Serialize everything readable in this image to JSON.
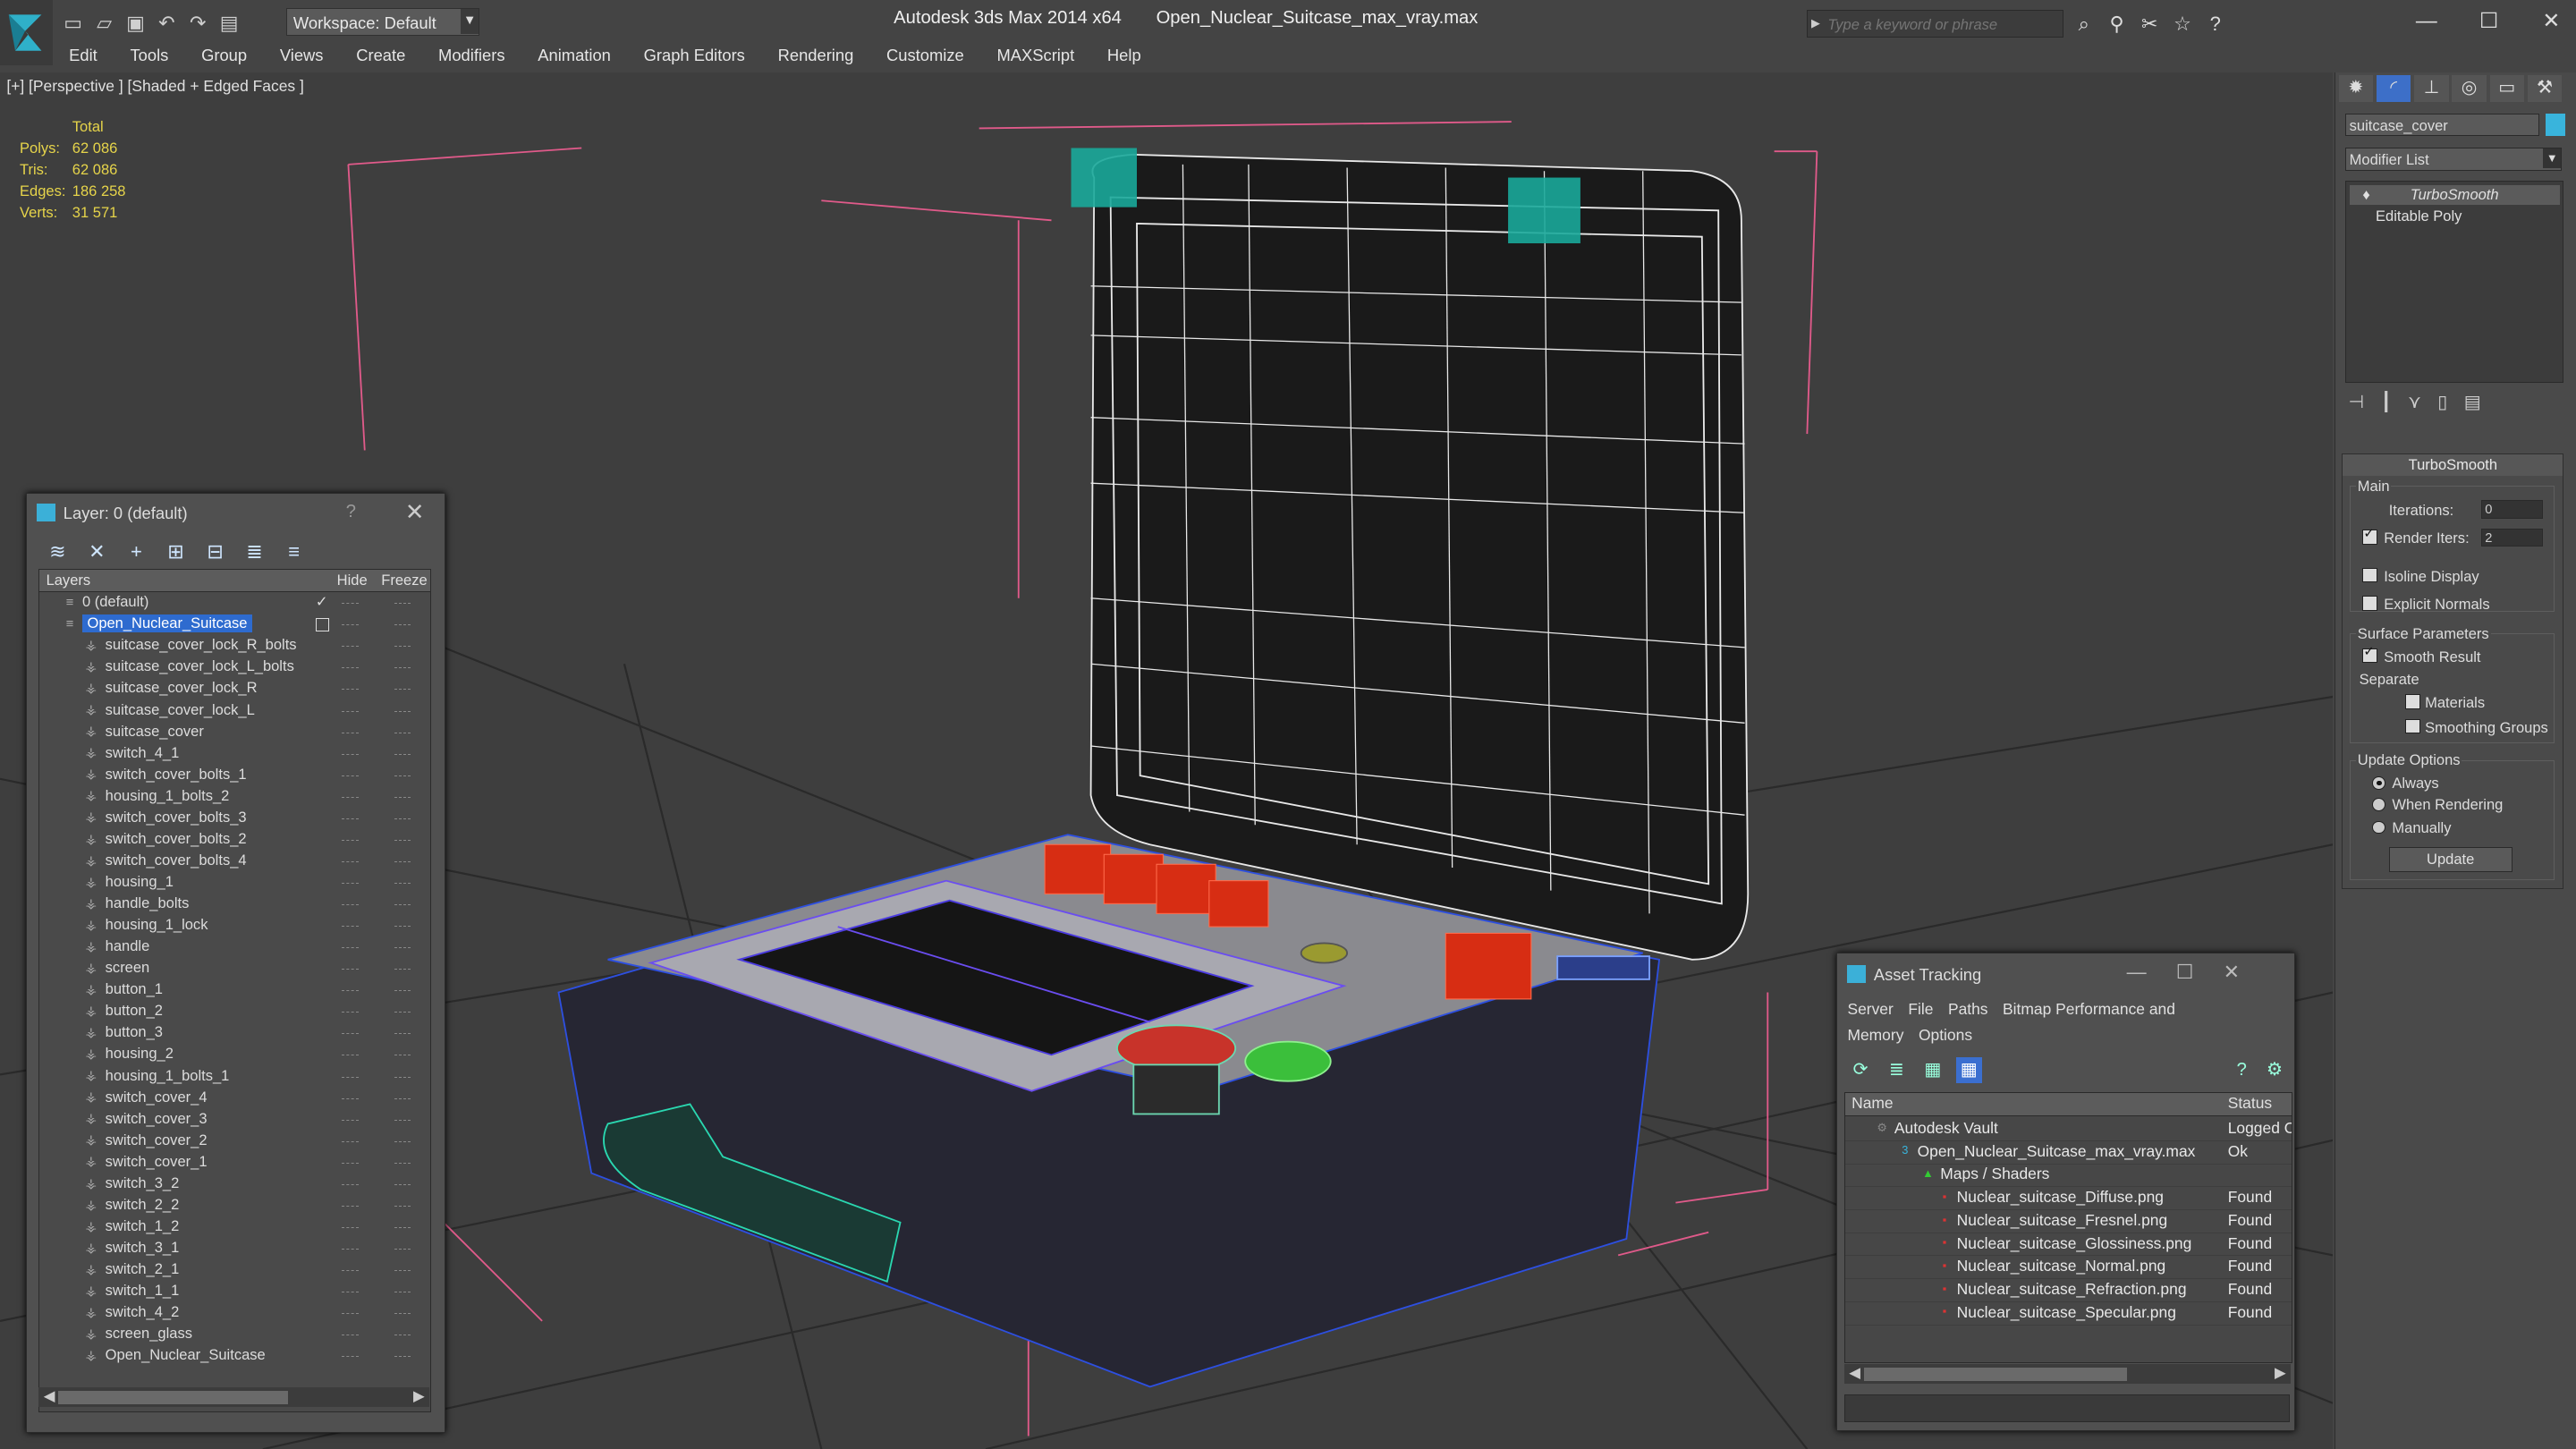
{
  "toolbar": {
    "workspace": "Workspace: Default",
    "app_name": "Autodesk 3ds Max  2014 x64",
    "file_name": "Open_Nuclear_Suitcase_max_vray.max",
    "search_placeholder": "Type a keyword or phrase"
  },
  "menu": [
    "Edit",
    "Tools",
    "Group",
    "Views",
    "Create",
    "Modifiers",
    "Animation",
    "Graph Editors",
    "Rendering",
    "Customize",
    "MAXScript",
    "Help"
  ],
  "viewport": {
    "label": "[+] [Perspective ] [Shaded + Edged Faces ]",
    "stats_header": "Total",
    "stats": [
      {
        "k": "Polys:",
        "v": "62 086"
      },
      {
        "k": "Tris:",
        "v": "62 086"
      },
      {
        "k": "Edges:",
        "v": "186 258"
      },
      {
        "k": "Verts:",
        "v": "31 571"
      }
    ]
  },
  "layer_window": {
    "title": "Layer: 0 (default)",
    "help": "?",
    "columns": {
      "layers": "Layers",
      "hide": "Hide",
      "freeze": "Freeze"
    },
    "rows": [
      {
        "name": "0 (default)",
        "level": 0
      },
      {
        "name": "Open_Nuclear_Suitcase",
        "level": 0,
        "selected": true
      },
      {
        "name": "suitcase_cover_lock_R_bolts",
        "level": 1
      },
      {
        "name": "suitcase_cover_lock_L_bolts",
        "level": 1
      },
      {
        "name": "suitcase_cover_lock_R",
        "level": 1
      },
      {
        "name": "suitcase_cover_lock_L",
        "level": 1
      },
      {
        "name": "suitcase_cover",
        "level": 1
      },
      {
        "name": "switch_4_1",
        "level": 1
      },
      {
        "name": "switch_cover_bolts_1",
        "level": 1
      },
      {
        "name": "housing_1_bolts_2",
        "level": 1
      },
      {
        "name": "switch_cover_bolts_3",
        "level": 1
      },
      {
        "name": "switch_cover_bolts_2",
        "level": 1
      },
      {
        "name": "switch_cover_bolts_4",
        "level": 1
      },
      {
        "name": "housing_1",
        "level": 1
      },
      {
        "name": "handle_bolts",
        "level": 1
      },
      {
        "name": "housing_1_lock",
        "level": 1
      },
      {
        "name": "handle",
        "level": 1
      },
      {
        "name": "screen",
        "level": 1
      },
      {
        "name": "button_1",
        "level": 1
      },
      {
        "name": "button_2",
        "level": 1
      },
      {
        "name": "button_3",
        "level": 1
      },
      {
        "name": "housing_2",
        "level": 1
      },
      {
        "name": "housing_1_bolts_1",
        "level": 1
      },
      {
        "name": "switch_cover_4",
        "level": 1
      },
      {
        "name": "switch_cover_3",
        "level": 1
      },
      {
        "name": "switch_cover_2",
        "level": 1
      },
      {
        "name": "switch_cover_1",
        "level": 1
      },
      {
        "name": "switch_3_2",
        "level": 1
      },
      {
        "name": "switch_2_2",
        "level": 1
      },
      {
        "name": "switch_1_2",
        "level": 1
      },
      {
        "name": "switch_3_1",
        "level": 1
      },
      {
        "name": "switch_2_1",
        "level": 1
      },
      {
        "name": "switch_1_1",
        "level": 1
      },
      {
        "name": "switch_4_2",
        "level": 1
      },
      {
        "name": "screen_glass",
        "level": 1
      },
      {
        "name": "Open_Nuclear_Suitcase",
        "level": 1
      }
    ]
  },
  "asset_window": {
    "title": "Asset Tracking",
    "menu": [
      "Server",
      "File",
      "Paths",
      "Bitmap Performance and Memory",
      "Options"
    ],
    "columns": {
      "name": "Name",
      "status": "Status"
    },
    "rows": [
      {
        "name": "Autodesk Vault",
        "status": "Logged O",
        "level": 0
      },
      {
        "name": "Open_Nuclear_Suitcase_max_vray.max",
        "status": "Ok",
        "level": 1
      },
      {
        "name": "Maps / Shaders",
        "status": "",
        "level": 2
      },
      {
        "name": "Nuclear_suitcase_Diffuse.png",
        "status": "Found",
        "level": 3
      },
      {
        "name": "Nuclear_suitcase_Fresnel.png",
        "status": "Found",
        "level": 3
      },
      {
        "name": "Nuclear_suitcase_Glossiness.png",
        "status": "Found",
        "level": 3
      },
      {
        "name": "Nuclear_suitcase_Normal.png",
        "status": "Found",
        "level": 3
      },
      {
        "name": "Nuclear_suitcase_Refraction.png",
        "status": "Found",
        "level": 3
      },
      {
        "name": "Nuclear_suitcase_Specular.png",
        "status": "Found",
        "level": 3
      }
    ]
  },
  "command_panel": {
    "object_name": "suitcase_cover",
    "object_color": "#39b4dc",
    "modifier_list": "Modifier List",
    "stack": [
      "TurboSmooth",
      "Editable Poly"
    ],
    "rollout_title": "TurboSmooth",
    "main_label": "Main",
    "iterations_label": "Iterations:",
    "iterations_value": "0",
    "render_iters_label": "Render Iters:",
    "render_iters_value": "2",
    "isoline_label": "Isoline Display",
    "explicit_normals_label": "Explicit Normals",
    "surface_params_label": "Surface Parameters",
    "smooth_result_label": "Smooth Result",
    "separate_label": "Separate",
    "materials_label": "Materials",
    "smoothing_groups_label": "Smoothing Groups",
    "update_options_label": "Update Options",
    "always_label": "Always",
    "when_rendering_label": "When Rendering",
    "manually_label": "Manually",
    "update_button": "Update",
    "render_iters_checked": true,
    "smooth_result_checked": true
  }
}
